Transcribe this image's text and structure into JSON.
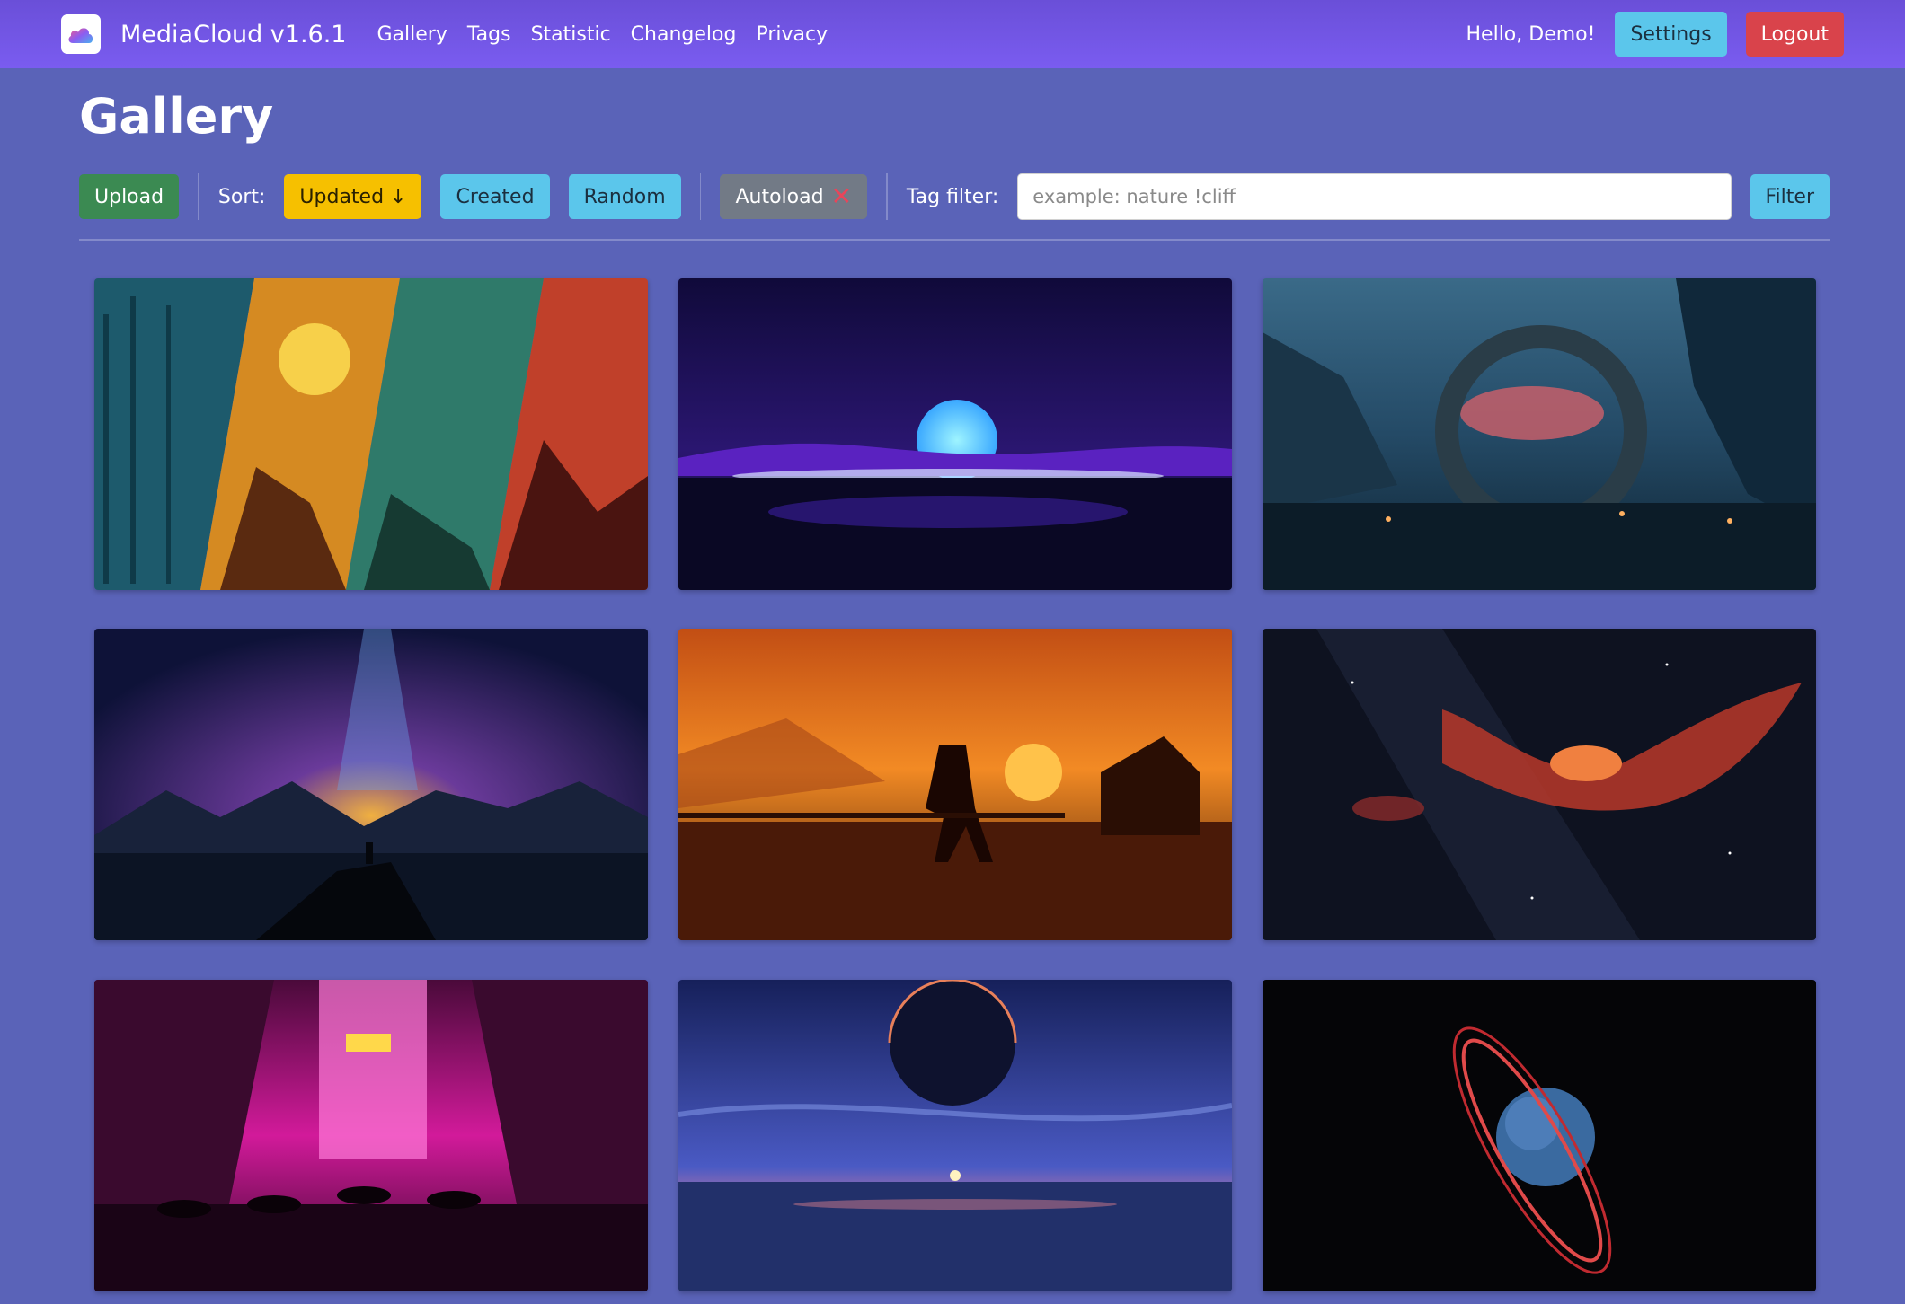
{
  "navbar": {
    "brand": "MediaCloud v1.6.1",
    "links": [
      "Gallery",
      "Tags",
      "Statistic",
      "Changelog",
      "Privacy"
    ],
    "greeting": "Hello, Demo!",
    "settings_label": "Settings",
    "logout_label": "Logout"
  },
  "page": {
    "title": "Gallery"
  },
  "toolbar": {
    "upload_label": "Upload",
    "sort_label": "Sort:",
    "sort_updated": "Updated ↓",
    "sort_created": "Created",
    "sort_random": "Random",
    "autoload_label": "Autoload",
    "autoload_state_icon": "x-icon",
    "tag_filter_label": "Tag filter:",
    "tag_filter_placeholder": "example: nature !cliff",
    "tag_filter_value": "",
    "filter_button": "Filter"
  },
  "colors": {
    "background": "#5a63b8",
    "navbar": "#6a4fd8",
    "info": "#5bc6eb",
    "danger": "#d9434b",
    "success": "#3b8a52",
    "warning": "#f6c000",
    "secondary": "#727a86"
  },
  "gallery": {
    "images": [
      {
        "subject": "star-wars-panels"
      },
      {
        "subject": "synthwave-sun-island"
      },
      {
        "subject": "stone-ring-portal-lake"
      },
      {
        "subject": "cosmic-sky-figure-cliff"
      },
      {
        "subject": "cowboy-sunset-ranch"
      },
      {
        "subject": "red-nebula-space"
      },
      {
        "subject": "neon-city-rain-umbrellas"
      },
      {
        "subject": "planet-ocean-sunset"
      },
      {
        "subject": "ringed-planet-dark"
      }
    ]
  }
}
